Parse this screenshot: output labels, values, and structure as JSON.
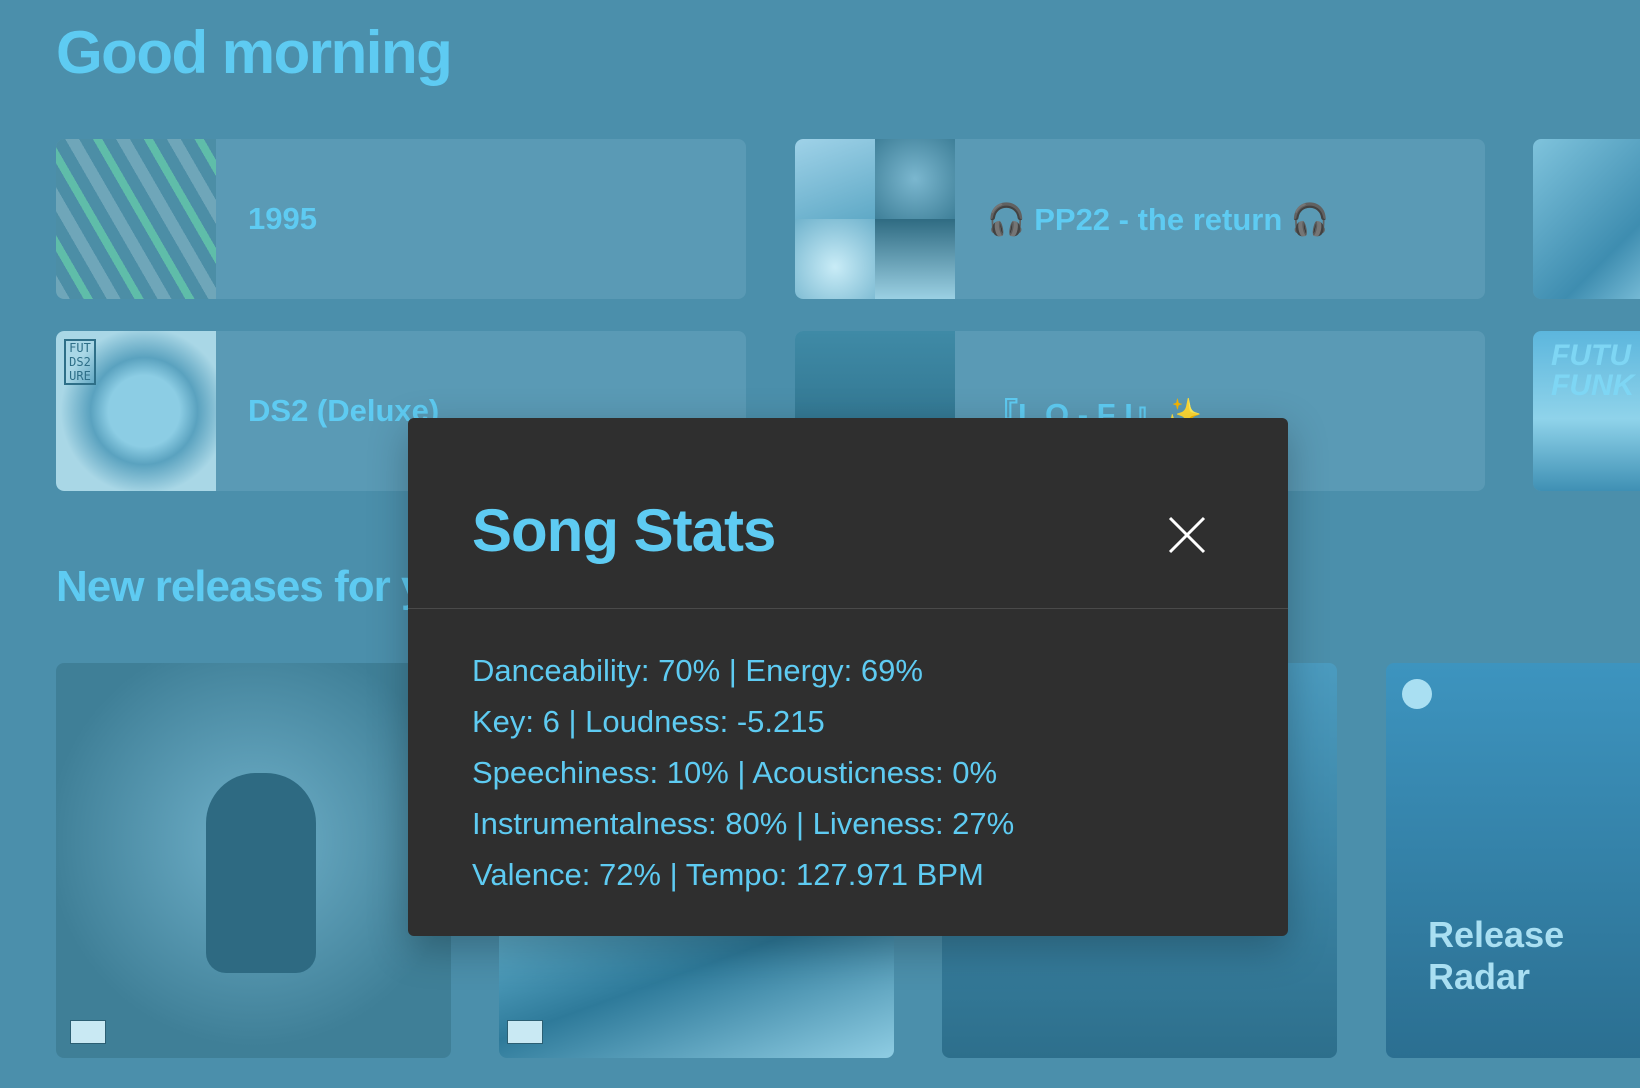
{
  "home": {
    "greeting": "Good morning",
    "section_title": "New releases for you",
    "shortcuts": [
      {
        "label": "1995"
      },
      {
        "label": "🎧 PP22 - the return 🎧"
      },
      {
        "label": ""
      },
      {
        "label": "DS2 (Deluxe)"
      },
      {
        "label": "『L O - F I』✨"
      },
      {
        "label": ""
      }
    ],
    "ds2_tag": "FUT DS2 URE",
    "funk_text": "FUTU FUNK",
    "release_radar": {
      "line1": "Release",
      "line2": "Radar"
    }
  },
  "modal": {
    "title": "Song Stats",
    "stats": [
      "Danceability: 70% | Energy: 69%",
      "Key: 6 | Loudness: -5.215",
      "Speechiness: 10% | Acousticness: 0%",
      "Instrumentalness: 80% | Liveness: 27%",
      "Valence: 72% | Tempo: 127.971 BPM"
    ]
  },
  "colors": {
    "background": "#4b8fab",
    "accent": "#5ecbf2",
    "modal_bg": "#2f2f2f"
  },
  "icons": {
    "close": "close-icon",
    "spotify": "spotify-logo-icon"
  }
}
